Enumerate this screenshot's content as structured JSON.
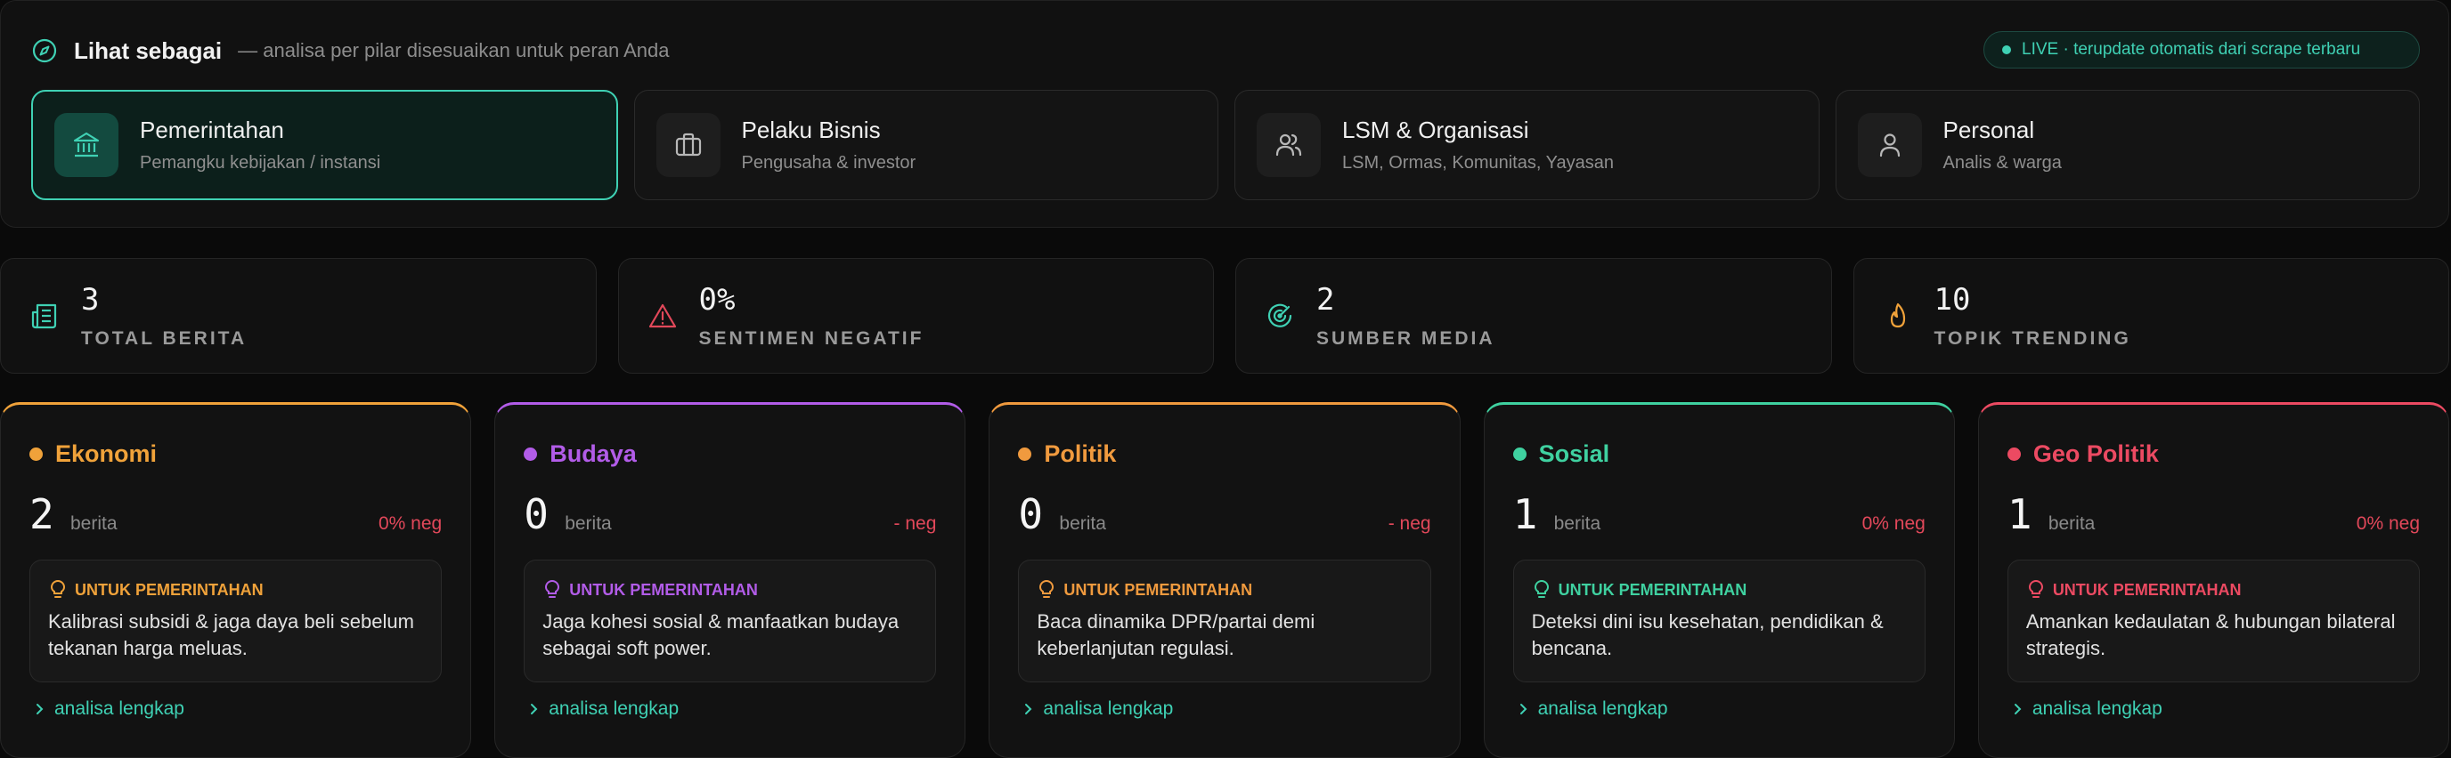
{
  "header": {
    "title": "Lihat sebagai",
    "subtitle": "— analisa per pilar disesuaikan untuk peran Anda",
    "live_badge": "LIVE · terupdate otomatis dari scrape terbaru"
  },
  "roles": [
    {
      "name": "Pemerintahan",
      "desc": "Pemangku kebijakan / instansi",
      "icon": "government-building-icon",
      "active": true
    },
    {
      "name": "Pelaku Bisnis",
      "desc": "Pengusaha & investor",
      "icon": "briefcase-icon",
      "active": false
    },
    {
      "name": "LSM & Organisasi",
      "desc": "LSM, Ormas, Komunitas, Yayasan",
      "icon": "users-icon",
      "active": false
    },
    {
      "name": "Personal",
      "desc": "Analis & warga",
      "icon": "user-icon",
      "active": false
    }
  ],
  "stats": [
    {
      "value": "3",
      "label": "TOTAL BERITA",
      "icon": "newspaper-icon",
      "color": "#3fd1b4"
    },
    {
      "value": "0%",
      "label": "SENTIMEN NEGATIF",
      "icon": "warning-icon",
      "color": "#e2485a"
    },
    {
      "value": "2",
      "label": "SUMBER MEDIA",
      "icon": "radar-icon",
      "color": "#3fd1b4"
    },
    {
      "value": "10",
      "label": "TOPIK TRENDING",
      "icon": "flame-icon",
      "color": "#f0a23a"
    }
  ],
  "pillars": [
    {
      "name": "Ekonomi",
      "color": "#f0a23a",
      "count": "2",
      "unit": "berita",
      "neg": "0% neg",
      "tip_label": "UNTUK PEMERINTAHAN",
      "tip": "Kalibrasi subsidi & jaga daya beli sebelum tekanan harga meluas.",
      "link": "analisa lengkap"
    },
    {
      "name": "Budaya",
      "color": "#b25ce8",
      "count": "0",
      "unit": "berita",
      "neg": "- neg",
      "tip_label": "UNTUK PEMERINTAHAN",
      "tip": "Jaga kohesi sosial & manfaatkan budaya sebagai soft power.",
      "link": "analisa lengkap"
    },
    {
      "name": "Politik",
      "color": "#f09a3e",
      "count": "0",
      "unit": "berita",
      "neg": "- neg",
      "tip_label": "UNTUK PEMERINTAHAN",
      "tip": "Baca dinamika DPR/partai demi keberlanjutan regulasi.",
      "link": "analisa lengkap"
    },
    {
      "name": "Sosial",
      "color": "#3fd1a0",
      "count": "1",
      "unit": "berita",
      "neg": "0% neg",
      "tip_label": "UNTUK PEMERINTAHAN",
      "tip": "Deteksi dini isu kesehatan, pendidikan & bencana.",
      "link": "analisa lengkap"
    },
    {
      "name": "Geo Politik",
      "color": "#ec4a62",
      "count": "1",
      "unit": "berita",
      "neg": "0% neg",
      "tip_label": "UNTUK PEMERINTAHAN",
      "tip": "Amankan kedaulatan & hubungan bilateral strategis.",
      "link": "analisa lengkap"
    }
  ]
}
